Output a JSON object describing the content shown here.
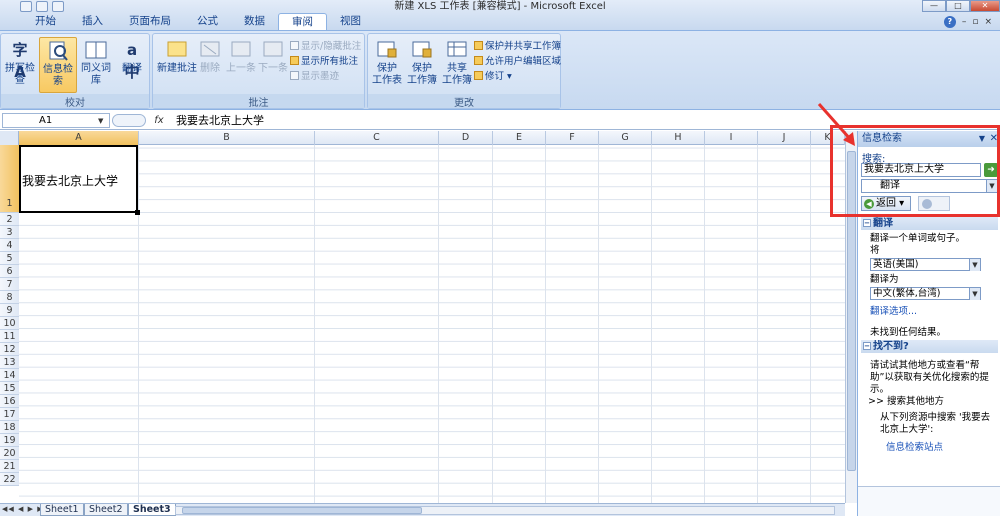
{
  "app": {
    "title": "新建 XLS 工作表  [兼容模式] - Microsoft Excel",
    "tabs": [
      "开始",
      "插入",
      "页面布局",
      "公式",
      "数据",
      "审阅",
      "视图"
    ],
    "active_tab": "审阅"
  },
  "ribbon": {
    "proofing": {
      "label": "校对",
      "spelling": "拼写检查",
      "research": "信息检索",
      "thesaurus": "同义词库",
      "translate": "翻译"
    },
    "comments": {
      "label": "批注",
      "new": "新建批注",
      "delete": "删除",
      "previous": "上一条",
      "next": "下一条",
      "show_hide": "显示/隐藏批注",
      "show_all": "显示所有批注",
      "show_ink": "显示墨迹"
    },
    "changes": {
      "label": "更改",
      "protect_sheet": [
        "保护",
        "工作表"
      ],
      "protect_workbook": [
        "保护",
        "工作簿"
      ],
      "share_workbook": [
        "共享",
        "工作簿"
      ],
      "protect_share": "保护并共享工作簿",
      "allow_edit": "允许用户编辑区域",
      "track_changes": "修订"
    }
  },
  "formula_bar": {
    "name_box": "A1",
    "fx": "fx",
    "content": "我要去北京上大学"
  },
  "grid": {
    "columns": [
      "A",
      "B",
      "C",
      "D",
      "E",
      "F",
      "G",
      "H",
      "I",
      "J",
      "K"
    ],
    "rows": [
      "1",
      "2",
      "3",
      "4",
      "5",
      "6",
      "7",
      "8",
      "9",
      "10",
      "11",
      "12",
      "13",
      "14",
      "15",
      "16",
      "17",
      "18",
      "19",
      "20",
      "21",
      "22"
    ],
    "selected_cell": "A1",
    "cell_a1": "我要去北京上大学"
  },
  "sheets": [
    "Sheet1",
    "Sheet2",
    "Sheet3"
  ],
  "active_sheet": "Sheet3",
  "research_pane": {
    "title": "信息检索",
    "search_label": "搜索:",
    "search_value": "我要去北京上大学",
    "source": "翻译",
    "back": "返回",
    "section_translate": "翻译",
    "translate_hint": "翻译一个单词或句子。",
    "from_label": "将",
    "from_lang": "英语(美国)",
    "to_label": "翻译为",
    "to_lang": "中文(繁体,台湾)",
    "options_link": "翻译选项...",
    "no_results": "未找到任何结果。",
    "section_not_found": "找不到?",
    "try_text": "请试试其他地方或查看“帮助”以获取有关优化搜索的提示。",
    "other_places": ">> 搜索其他地方",
    "from_sources": "从下列资源中搜索 '我要去北京上大学':",
    "research_sites": "信息检索站点"
  },
  "colors": {
    "ribbon_bg": "#c7d9f0",
    "active_button": "#f8c962",
    "highlight": "#e8322d"
  }
}
